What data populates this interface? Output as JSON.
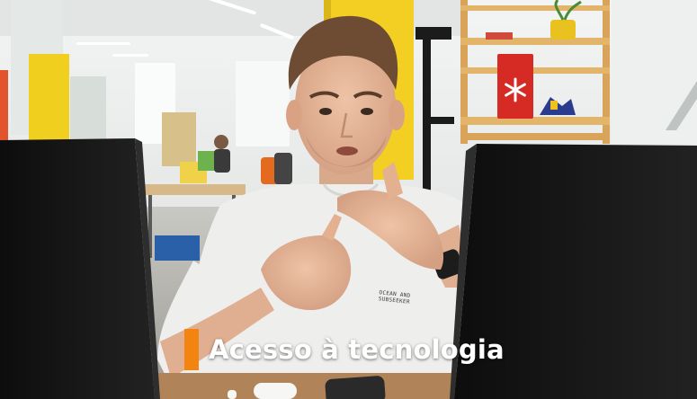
{
  "caption": {
    "text": "Acesso à tecnologia",
    "accent_color": "#f2840f"
  },
  "shirt_print": {
    "line1": "OCEAN AND",
    "line2": "SUBSEEKER"
  },
  "palette": {
    "wall": "#e9ecea",
    "pillar": "#f0cf1f",
    "shelf_wood": "#e3b56a",
    "shirt": "#eeeeec",
    "skin": "#e6b79b",
    "hair": "#6d4c33",
    "monitor": "#151515",
    "desk": "#b08458",
    "red_box": "#d62a24"
  }
}
